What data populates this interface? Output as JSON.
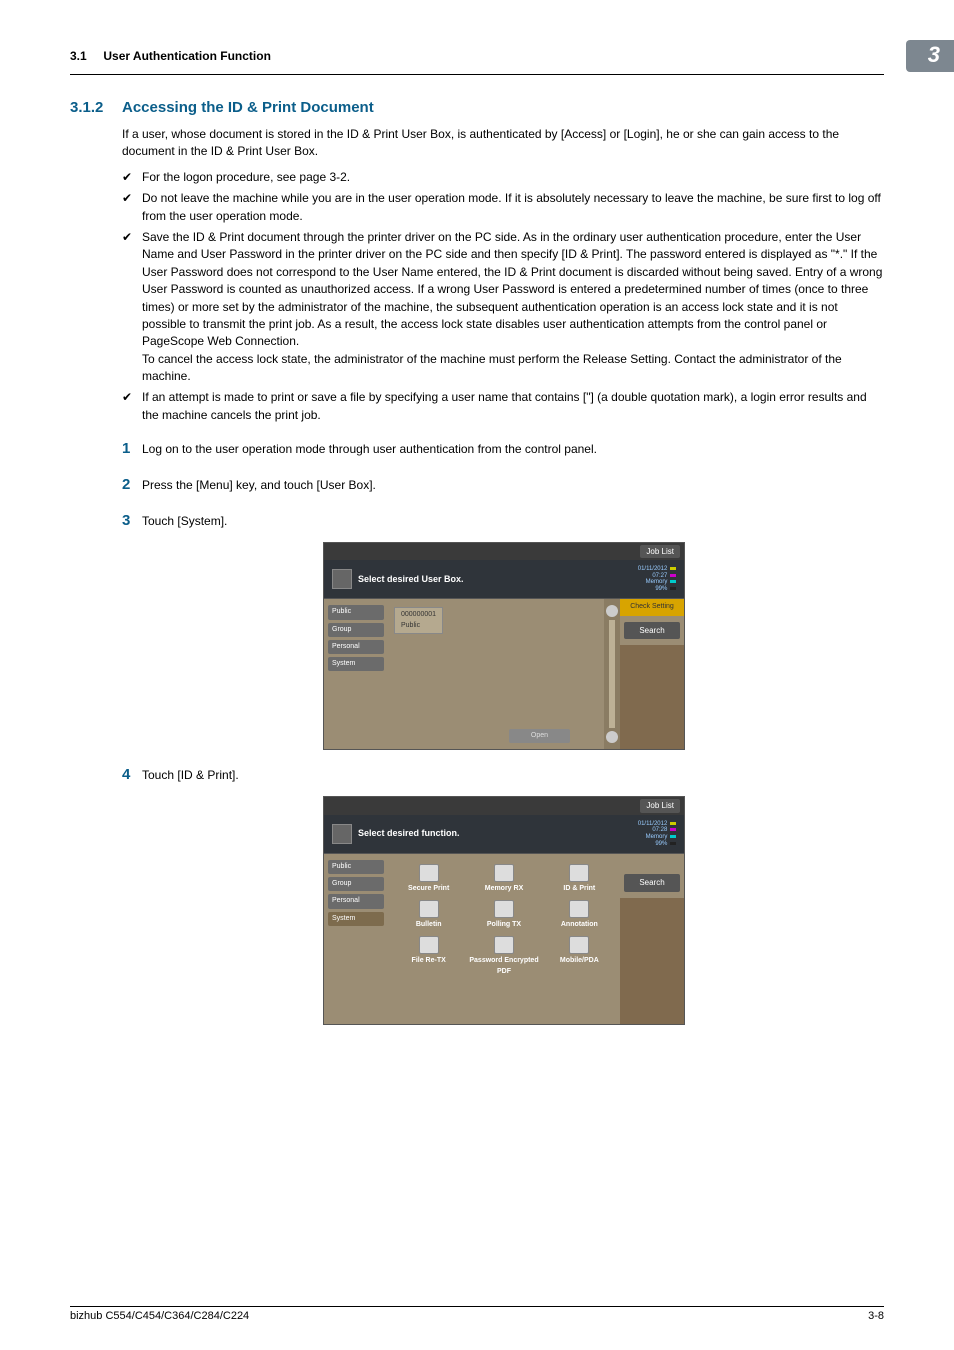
{
  "header": {
    "section_ref": "3.1",
    "section_title": "User Authentication Function",
    "chapter_badge": "3"
  },
  "section": {
    "number": "3.1.2",
    "title": "Accessing the ID & Print Document",
    "intro": "If a user, whose document is stored in the ID & Print User Box, is authenticated by [Access] or [Login], he or she can gain access to the document in the ID & Print User Box.",
    "bullets": [
      "For the logon procedure, see page 3-2.",
      "Do not leave the machine while you are in the user operation mode. If it is absolutely necessary to leave the machine, be sure first to log off from the user operation mode.",
      "Save the ID & Print document through the printer driver on the PC side. As in the ordinary user authentication procedure, enter the User Name and User Password in the printer driver on the PC side and then specify [ID & Print]. The password entered is displayed as \"*.\" If the User Password does not correspond to the User Name entered, the ID & Print document is discarded without being saved. Entry of a wrong User Password is counted as unauthorized access. If a wrong User Password is entered a predetermined number of times (once to three times) or more set by the administrator of the machine, the subsequent authentication operation is an access lock state and it is not possible to transmit the print job. As a result, the access lock state disables user authentication attempts from the control panel or PageScope Web Connection.\nTo cancel the access lock state, the administrator of the machine must perform the Release Setting. Contact the administrator of the machine.",
      "If an attempt is made to print or save a file by specifying a user name that contains [\"] (a double quotation mark), a login error results and the machine cancels the print job."
    ],
    "steps": [
      "Log on to the user operation mode through user authentication from the control panel.",
      "Press the [Menu] key, and touch [User Box].",
      "Touch [System].",
      "Touch [ID & Print]."
    ]
  },
  "screenshot1": {
    "job_list": "Job List",
    "banner": "Select desired User Box.",
    "date": "01/11/2012",
    "time": "07:27",
    "memory_label": "Memory",
    "memory_value": "99%",
    "toner": {
      "y": "Y",
      "m": "M",
      "c": "C",
      "k": "K"
    },
    "check_setting": "Check Setting",
    "tabs": [
      "Public",
      "Group",
      "Personal",
      "System"
    ],
    "box_id": "000000001",
    "box_name": "Public",
    "search": "Search",
    "open": "Open"
  },
  "screenshot2": {
    "job_list": "Job List",
    "banner": "Select desired function.",
    "date": "01/11/2012",
    "time": "07:28",
    "memory_label": "Memory",
    "memory_value": "99%",
    "tabs": [
      "Public",
      "Group",
      "Personal",
      "System"
    ],
    "active_tab": "System",
    "search": "Search",
    "items": [
      "Secure Print",
      "Memory RX",
      "ID & Print",
      "Bulletin",
      "Polling TX",
      "Annotation",
      "File Re-TX",
      "Password Encrypted PDF",
      "Mobile/PDA"
    ]
  },
  "footer": {
    "left": "bizhub C554/C454/C364/C284/C224",
    "right": "3-8"
  }
}
